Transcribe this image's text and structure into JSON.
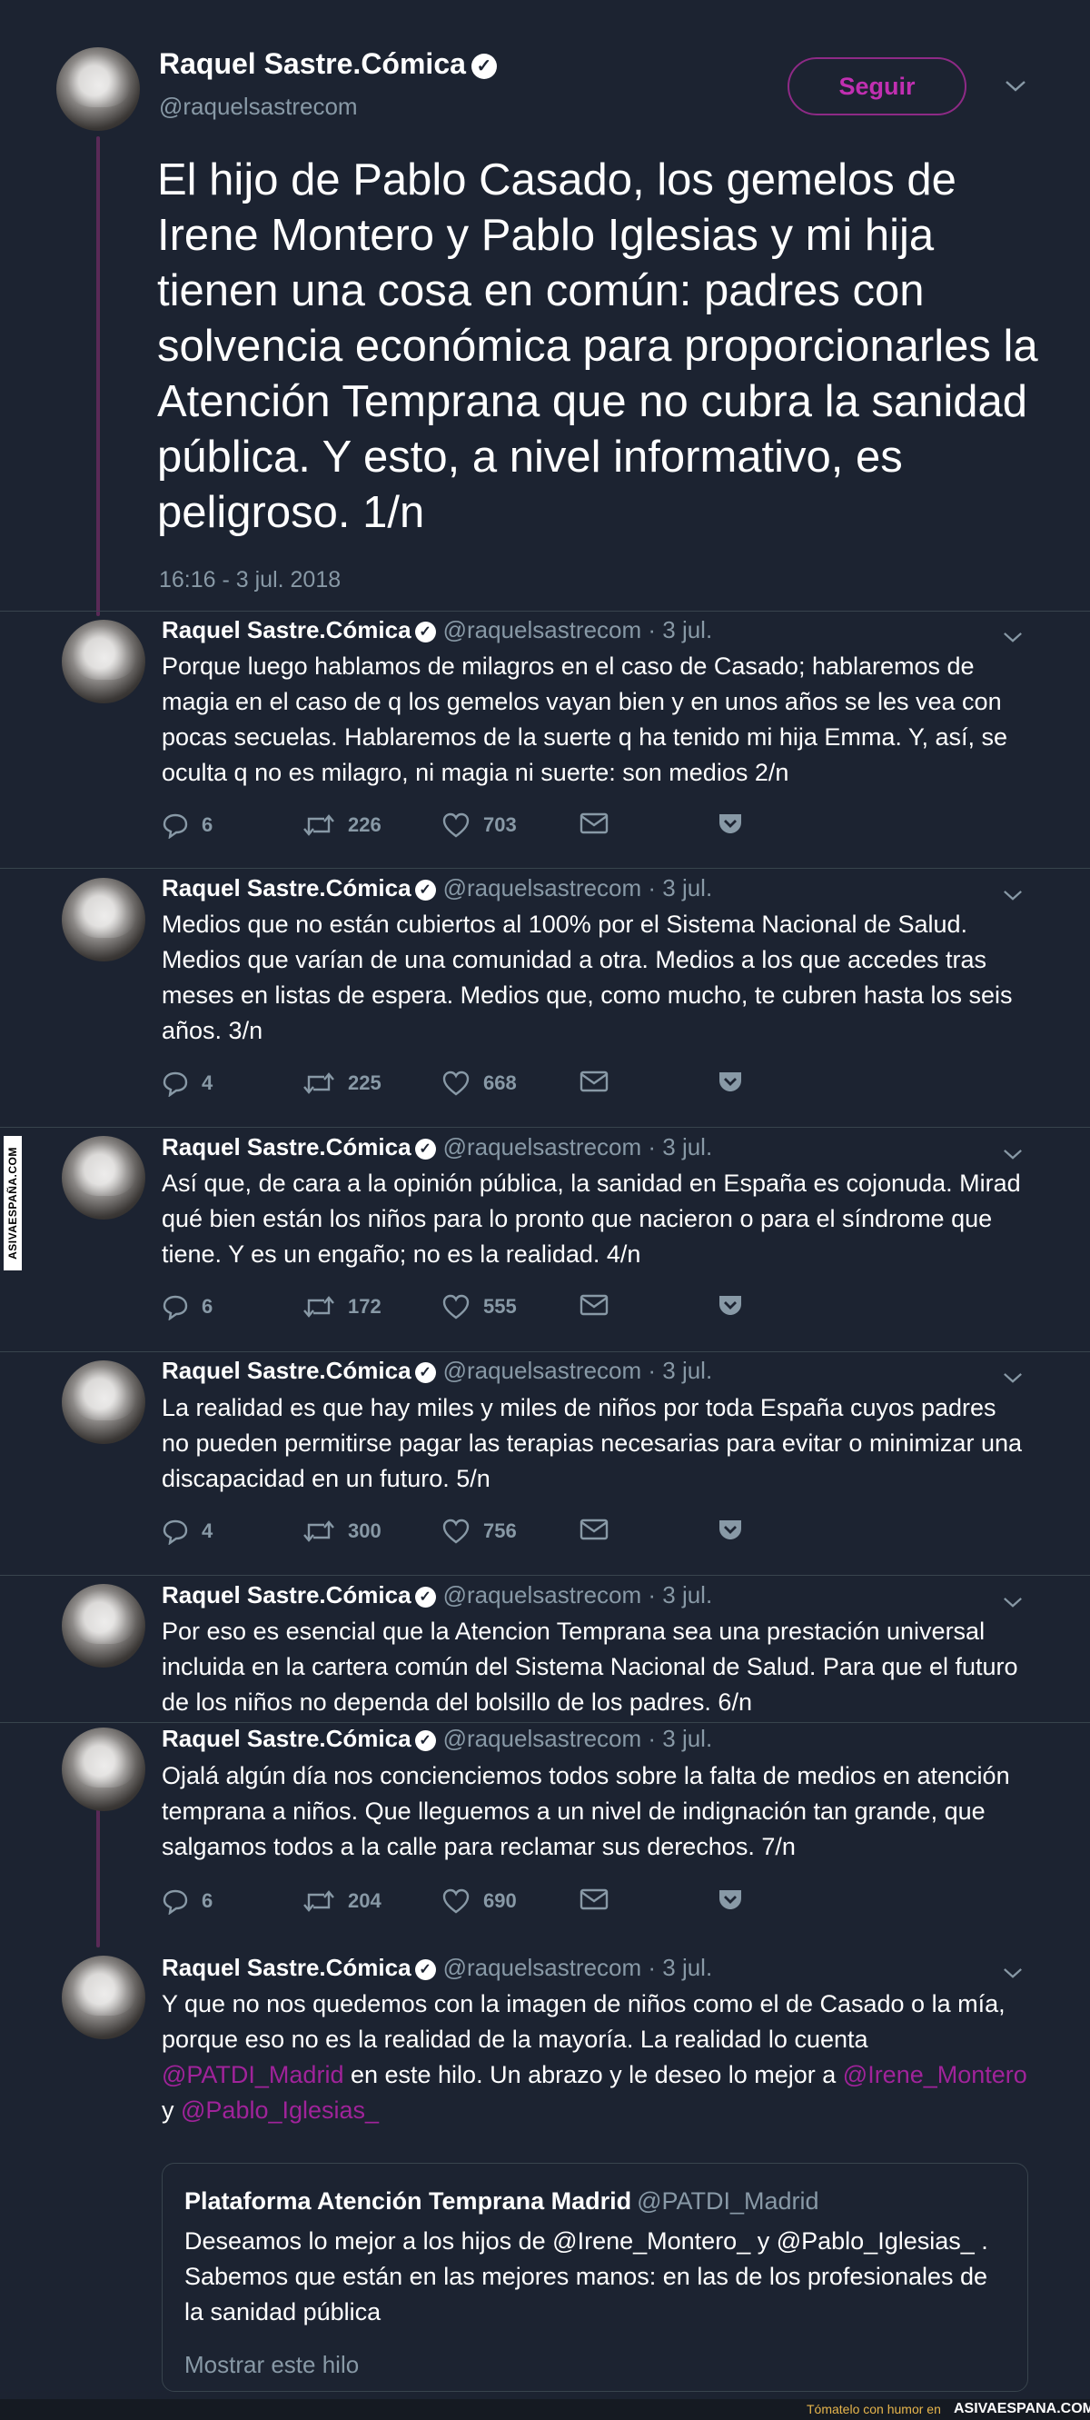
{
  "main_tweet": {
    "name": "Raquel Sastre.Cómica",
    "handle": "@raquelsastrecom",
    "follow_label": "Seguir",
    "text": "El hijo de Pablo Casado, los gemelos de Irene Montero y Pablo Iglesias y mi hija tienen una cosa en común: padres con solvencia económica para proporcionarles la Atención Temprana que no cubra la sanidad pública. Y esto, a nivel informativo, es peligroso. 1/n",
    "timestamp": "16:16 - 3 jul. 2018"
  },
  "replies": [
    {
      "name": "Raquel Sastre.Cómica",
      "meta": "@raquelsastrecom · 3 jul.",
      "text": "Porque luego hablamos de milagros en el caso de Casado; hablaremos de magia en el caso de q los gemelos vayan bien y en unos años se les vea con pocas secuelas. Hablaremos de la suerte q ha tenido mi hija Emma. Y, así, se oculta q no es milagro, ni magia ni suerte: son medios 2/n",
      "replies": "6",
      "retweets": "226",
      "likes": "703"
    },
    {
      "name": "Raquel Sastre.Cómica",
      "meta": "@raquelsastrecom · 3 jul.",
      "text": "Medios que no están cubiertos al 100% por el Sistema Nacional de Salud. Medios que varían de una comunidad a otra. Medios a los que accedes tras meses en listas de espera. Medios que, como mucho, te cubren hasta los seis años. 3/n",
      "replies": "4",
      "retweets": "225",
      "likes": "668"
    },
    {
      "name": "Raquel Sastre.Cómica",
      "meta": "@raquelsastrecom · 3 jul.",
      "text": "Así que, de cara a la opinión pública, la sanidad en España es cojonuda. Mirad qué bien están los niños para lo pronto que nacieron o para el síndrome que tiene. Y es un engaño; no es la realidad. 4/n",
      "replies": "6",
      "retweets": "172",
      "likes": "555"
    },
    {
      "name": "Raquel Sastre.Cómica",
      "meta": "@raquelsastrecom · 3 jul.",
      "text": "La realidad es que hay miles y miles de niños por toda España cuyos padres no pueden permitirse pagar las terapias necesarias para evitar o minimizar una discapacidad en un futuro. 5/n",
      "replies": "4",
      "retweets": "300",
      "likes": "756"
    },
    {
      "name": "Raquel Sastre.Cómica",
      "meta": "@raquelsastrecom · 3 jul.",
      "text": "Por eso es esencial que la Atencion Temprana sea una prestación universal incluida en la cartera común del Sistema Nacional de Salud. Para que el futuro de los niños no dependa del bolsillo de los padres. 6/n"
    },
    {
      "name": "Raquel Sastre.Cómica",
      "meta": "@raquelsastrecom · 3 jul.",
      "text": "Ojalá algún día nos concienciemos todos sobre la falta de medios en atención temprana a niños. Que lleguemos a un nivel de indignación tan grande, que salgamos todos a la calle para reclamar sus derechos. 7/n",
      "replies": "6",
      "retweets": "204",
      "likes": "690"
    },
    {
      "name": "Raquel Sastre.Cómica",
      "meta": "@raquelsastrecom · 3 jul.",
      "text_part1": "Y que no nos quedemos con la imagen de niños como el de Casado o la mía, porque eso no es la realidad de la mayoría. La realidad lo cuenta ",
      "mention1": "@PATDI_Madrid",
      "text_part2": " en este hilo. Un abrazo y le deseo lo mejor a ",
      "mention2": "@Irene_Montero",
      "text_part3": " y ",
      "mention3": "@Pablo_Iglesias_"
    }
  ],
  "quoted_tweet": {
    "name": "Plataforma Atención Temprana Madrid",
    "handle": "@PATDI_Madrid",
    "text": "Deseamos lo mejor a los hijos de @Irene_Montero_ y @Pablo_Iglesias_ . Sabemos que están en las mejores manos: en las de los profesionales de la sanidad pública",
    "show_thread": "Mostrar este hilo"
  },
  "watermark": {
    "side": "ASIVAESPAÑA.COM",
    "footer_left": "Tómatelo con humor en",
    "footer_right": "ASIVAESPANA.COM"
  },
  "colors": {
    "background": "#1c2331",
    "accent": "#a0239a",
    "muted": "#8899a6"
  }
}
